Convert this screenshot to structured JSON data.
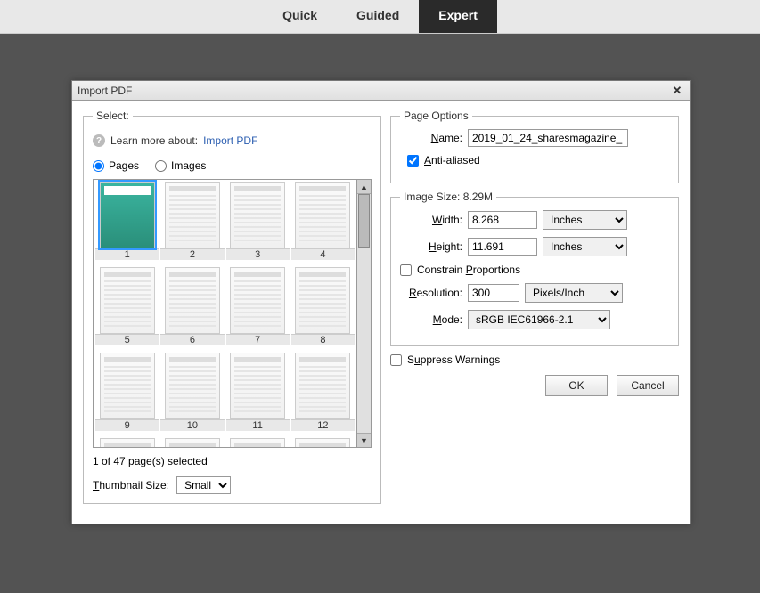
{
  "tabs": {
    "quick": "Quick",
    "guided": "Guided",
    "expert": "Expert"
  },
  "dialog": {
    "title": "Import PDF",
    "select": {
      "legend": "Select:",
      "learn_prefix": "Learn more about: ",
      "learn_link": "Import PDF",
      "radio_pages": "Pages",
      "radio_images": "Images",
      "status": "1 of 47 page(s) selected",
      "thumb_label": "Thumbnail Size:",
      "thumb_value": "Small",
      "pages": [
        "1",
        "2",
        "3",
        "4",
        "5",
        "6",
        "7",
        "8",
        "9",
        "10",
        "11",
        "12"
      ]
    },
    "page_options": {
      "legend": "Page Options",
      "name_label": "Name:",
      "name_value": "2019_01_24_sharesmagazine_",
      "anti_aliased": "Anti-aliased"
    },
    "image_size": {
      "legend": "Image Size: 8.29M",
      "width_label": "Width:",
      "width_value": "8.268",
      "height_label": "Height:",
      "height_value": "11.691",
      "unit": "Inches",
      "constrain": "Constrain Proportions",
      "res_label": "Resolution:",
      "res_value": "300",
      "res_unit": "Pixels/Inch",
      "mode_label": "Mode:",
      "mode_value": "sRGB IEC61966-2.1"
    },
    "suppress": "Suppress Warnings",
    "ok": "OK",
    "cancel": "Cancel"
  }
}
